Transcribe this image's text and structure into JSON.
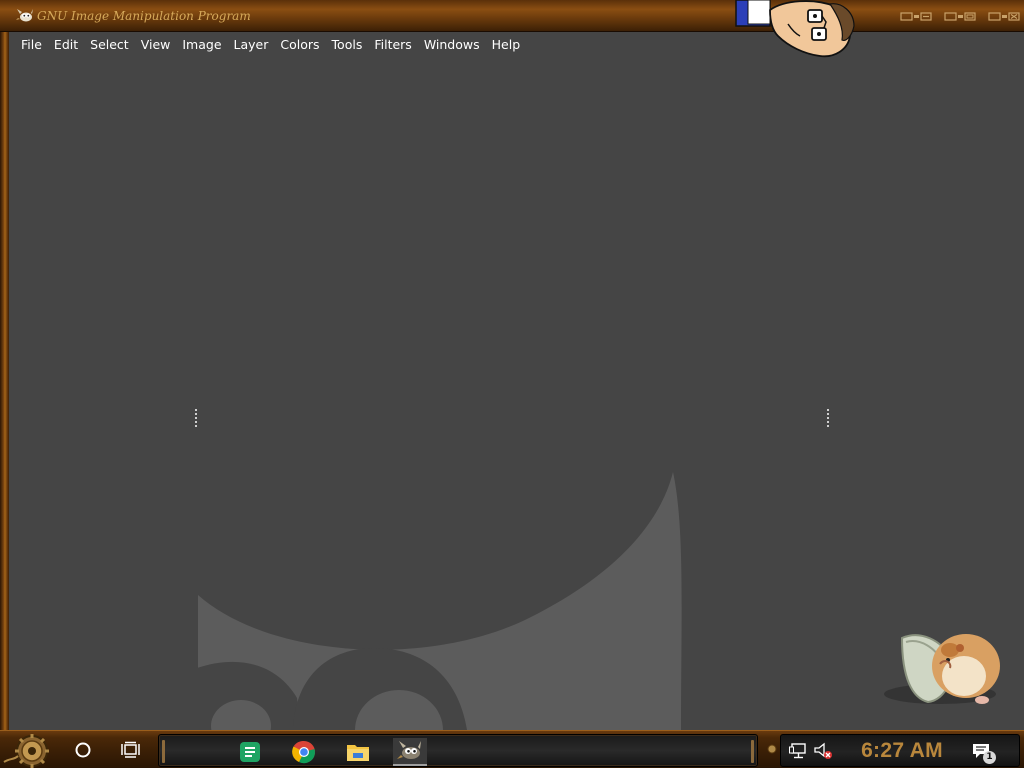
{
  "window": {
    "title": "GNU Image Manipulation Program",
    "app_icon": "gimp-wilber-icon"
  },
  "menubar": {
    "items": [
      {
        "label": "File"
      },
      {
        "label": "Edit"
      },
      {
        "label": "Select"
      },
      {
        "label": "View"
      },
      {
        "label": "Image"
      },
      {
        "label": "Layer"
      },
      {
        "label": "Colors"
      },
      {
        "label": "Tools"
      },
      {
        "label": "Filters"
      },
      {
        "label": "Windows"
      },
      {
        "label": "Help"
      }
    ]
  },
  "taskbar": {
    "start_icon": "steampunk-gear-start-icon",
    "search_icon": "cortana-circle-icon",
    "taskview_icon": "task-view-icon",
    "pinned_apps": [
      {
        "name": "google-sheets-icon",
        "color": "#1fa463"
      },
      {
        "name": "chrome-icon"
      },
      {
        "name": "file-explorer-icon",
        "color": "#f4c542"
      },
      {
        "name": "gimp-icon",
        "active": true
      }
    ],
    "tray": {
      "network_icon": "network-icon",
      "volume_icon": "volume-muted-icon",
      "clock": "6:27 AM",
      "notifications_icon": "action-center-icon",
      "notification_count": "1"
    }
  },
  "theme": {
    "frame_color": "#6b3c0f",
    "canvas_bg": "#454545",
    "watermark_color": "#5c5c5c",
    "clock_color": "#b9873c"
  }
}
